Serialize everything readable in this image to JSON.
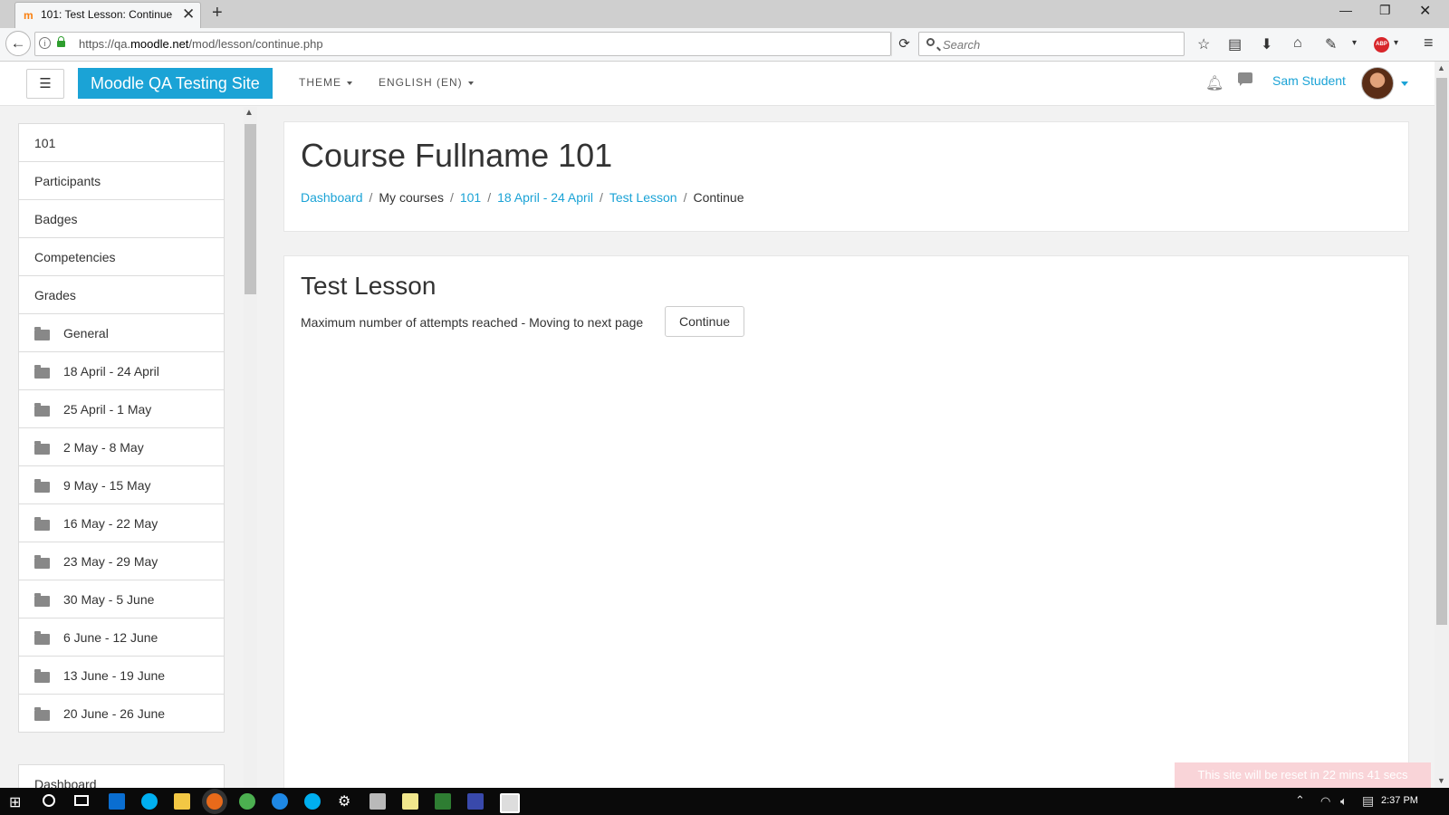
{
  "browser": {
    "tab_title": "101: Test Lesson: Continue",
    "tab_close": "✕",
    "new_tab": "+",
    "url_prefix": "https://qa.",
    "url_host": "moodle.net",
    "url_path": "/mod/lesson/continue.php",
    "search_placeholder": "Search"
  },
  "header": {
    "hamburger": "☰",
    "site_name": "Moodle QA Testing Site",
    "theme_menu": "THEME",
    "language_menu": "ENGLISH (EN)",
    "user_name": "Sam Student"
  },
  "drawer": {
    "items": [
      {
        "label": "101",
        "folder": false
      },
      {
        "label": "Participants",
        "folder": false
      },
      {
        "label": "Badges",
        "folder": false
      },
      {
        "label": "Competencies",
        "folder": false
      },
      {
        "label": "Grades",
        "folder": false
      },
      {
        "label": "General",
        "folder": true
      },
      {
        "label": "18 April - 24 April",
        "folder": true
      },
      {
        "label": "25 April - 1 May",
        "folder": true
      },
      {
        "label": "2 May - 8 May",
        "folder": true
      },
      {
        "label": "9 May - 15 May",
        "folder": true
      },
      {
        "label": "16 May - 22 May",
        "folder": true
      },
      {
        "label": "23 May - 29 May",
        "folder": true
      },
      {
        "label": "30 May - 5 June",
        "folder": true
      },
      {
        "label": "6 June - 12 June",
        "folder": true
      },
      {
        "label": "13 June - 19 June",
        "folder": true
      },
      {
        "label": "20 June - 26 June",
        "folder": true
      }
    ],
    "dashboard_label": "Dashboard"
  },
  "page": {
    "course_title": "Course Fullname 101",
    "breadcrumb": [
      {
        "label": "Dashboard",
        "link": true
      },
      {
        "label": "My courses",
        "link": false
      },
      {
        "label": "101",
        "link": true
      },
      {
        "label": "18 April - 24 April",
        "link": true
      },
      {
        "label": "Test Lesson",
        "link": true
      },
      {
        "label": "Continue",
        "link": false
      }
    ],
    "breadcrumb_separator": "/",
    "lesson_title": "Test Lesson",
    "message": "Maximum number of attempts reached - Moving to next page",
    "continue_button": "Continue"
  },
  "reset_notice": "This site will be reset in 22 mins 41 secs",
  "taskbar": {
    "clock": "2:37 PM"
  },
  "colors": {
    "brand": "#1ba3d6",
    "reset_notice_bg": "#f9d4d8"
  }
}
